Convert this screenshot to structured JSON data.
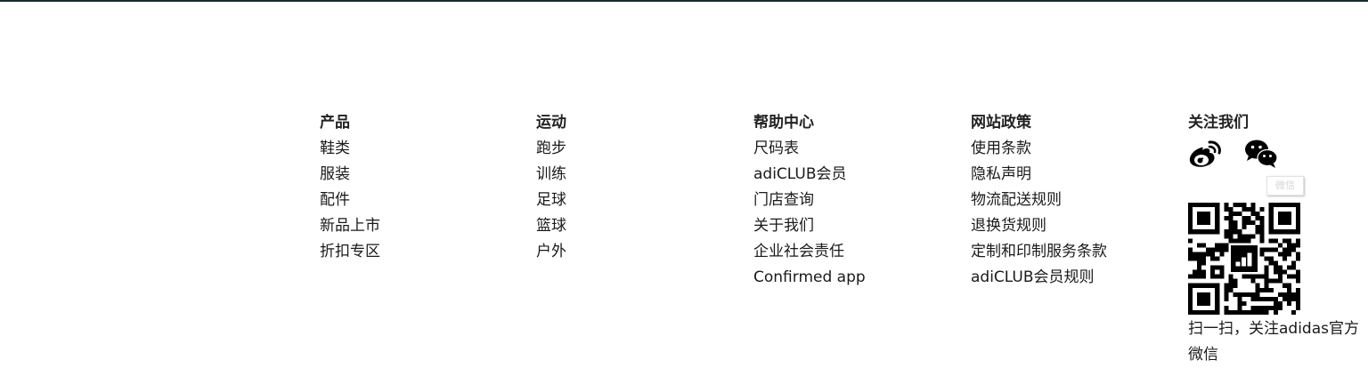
{
  "columns": [
    {
      "title": "产品",
      "links": [
        "鞋类",
        "服装",
        "配件",
        "新品上市",
        "折扣专区"
      ]
    },
    {
      "title": "运动",
      "links": [
        "跑步",
        "训练",
        "足球",
        "篮球",
        "户外"
      ]
    },
    {
      "title": "帮助中心",
      "links": [
        "尺码表",
        "adiCLUB会员",
        "门店查询",
        "关于我们",
        "企业社会责任",
        "Confirmed app"
      ]
    },
    {
      "title": "网站政策",
      "links": [
        "使用条款",
        "隐私声明",
        "物流配送规则",
        "退换货规则",
        "定制和印制服务条款",
        "adiCLUB会员规则"
      ]
    }
  ],
  "follow": {
    "title": "关注我们",
    "weibo_icon": "weibo-icon",
    "wechat_icon": "wechat-icon",
    "tooltip": "微信",
    "qr_caption": "扫一扫，关注adidas官方微信"
  },
  "colors": {
    "top_bar": "#1a2a2e",
    "text": "#1a1a1a",
    "heading": "#222222"
  }
}
